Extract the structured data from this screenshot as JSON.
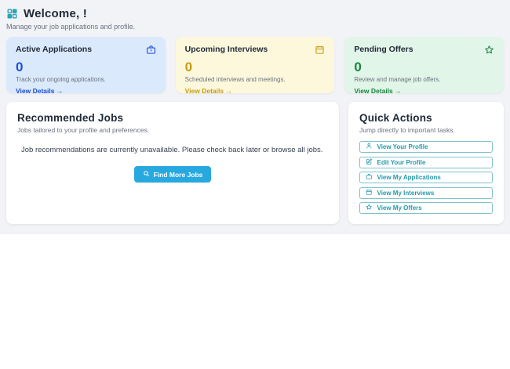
{
  "colors": {
    "page_band_bg": "#F2F3F6",
    "teal_accent": "#2599AC",
    "find_jobs_button_bg": "#27A9E0",
    "active_card_bg": "#DBE9FC",
    "active_accent": "#1D4ED8",
    "interviews_card_bg": "#FDF8DC",
    "interviews_accent": "#C99B12",
    "offers_card_bg": "#E2F5E9",
    "offers_accent": "#17863F"
  },
  "header": {
    "title": "Welcome, !",
    "subtitle": "Manage your job applications and profile.",
    "icon": "dashboard-grid-icon"
  },
  "stats": [
    {
      "title": "Active Applications",
      "value": "0",
      "description": "Track your ongoing applications.",
      "link": "View Details →",
      "icon": "briefcase-icon"
    },
    {
      "title": "Upcoming Interviews",
      "value": "0",
      "description": "Scheduled interviews and meetings.",
      "link": "View Details →",
      "icon": "calendar-icon"
    },
    {
      "title": "Pending Offers",
      "value": "0",
      "description": "Review and manage job offers.",
      "link": "View Details →",
      "icon": "star-icon"
    }
  ],
  "recommended": {
    "title": "Recommended Jobs",
    "subtitle": "Jobs tailored to your profile and preferences.",
    "empty_message": "Job recommendations are currently unavailable. Please check back later or browse all jobs.",
    "button_label": "Find More Jobs",
    "button_icon": "search-icon"
  },
  "quick_actions": {
    "title": "Quick Actions",
    "subtitle": "Jump directly to important tasks.",
    "actions": [
      {
        "label": "View Your Profile",
        "icon": "person-icon"
      },
      {
        "label": "Edit Your Profile",
        "icon": "edit-icon"
      },
      {
        "label": "View My Applications",
        "icon": "briefcase-icon"
      },
      {
        "label": "View My Interviews",
        "icon": "calendar-icon"
      },
      {
        "label": "View My Offers",
        "icon": "star-icon"
      }
    ]
  }
}
